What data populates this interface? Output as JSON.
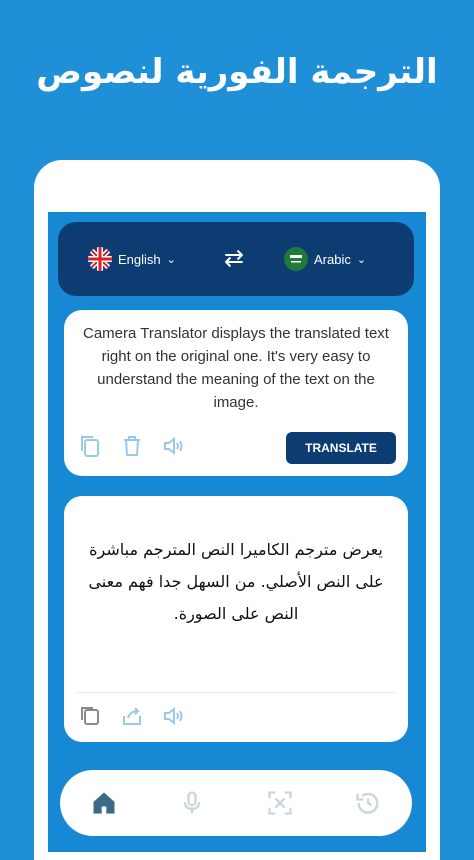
{
  "header": {
    "headline": "الترجمة الفورية لنصوص"
  },
  "language_bar": {
    "source_language": "English",
    "target_language": "Arabic",
    "swap_icon": "swap-arrows-icon"
  },
  "input_card": {
    "text": "Camera Translator displays the translated text right on the original one. It's very easy to understand the meaning of the text on the image.",
    "translate_label": "TRANSLATE",
    "icons": [
      "copy-icon",
      "delete-icon",
      "speaker-icon"
    ]
  },
  "output_card": {
    "text": "يعرض مترجم الكاميرا النص المترجم مباشرة على النص الأصلي. من السهل جدا فهم معنى النص على الصورة.",
    "icons": [
      "copy-icon",
      "share-icon",
      "speaker-icon"
    ]
  },
  "bottom_nav": {
    "items": [
      "home-icon",
      "microphone-icon",
      "scan-icon",
      "history-icon"
    ],
    "active": "home-icon"
  },
  "colors": {
    "background": "#1f8fd8",
    "navy": "#0d3c72",
    "icon_light": "#9cc9ea",
    "active_icon": "#3a6a85"
  }
}
